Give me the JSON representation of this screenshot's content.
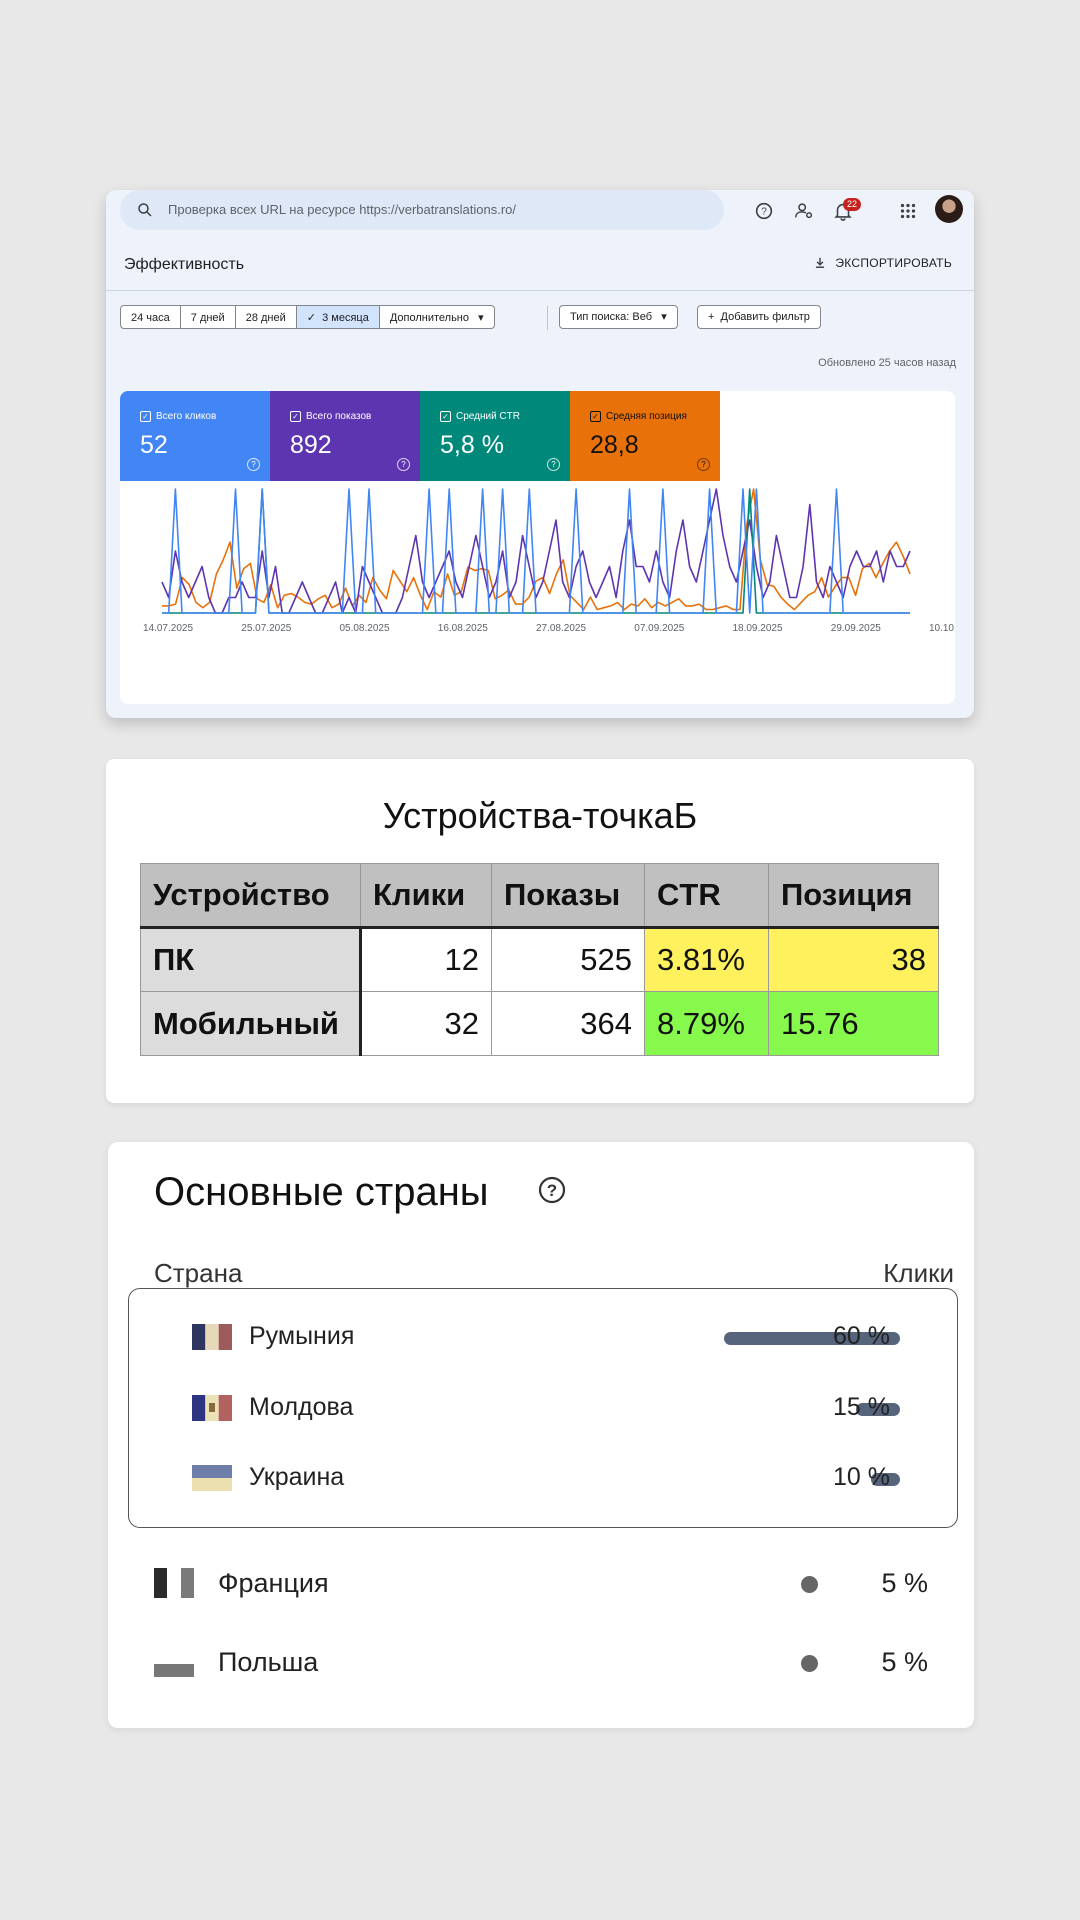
{
  "search_console": {
    "search_placeholder": "Проверка всех URL на ресурсе https://verbatranslations.ro/",
    "notifications_count": "22",
    "page_title": "Эффективность",
    "export_label": "ЭКСПОРТИРОВАТЬ",
    "date_filters": [
      "24 часа",
      "7 дней",
      "28 дней",
      "3 месяца",
      "Дополнительно"
    ],
    "active_date_filter": "3 месяца",
    "search_type_label": "Тип поиска: Веб",
    "add_filter_label": "Добавить фильтр",
    "updated_text": "Обновлено 25 часов назад",
    "metrics": [
      {
        "label": "Всего кликов",
        "value": "52",
        "color": "#4285f4"
      },
      {
        "label": "Всего показов",
        "value": "892",
        "color": "#5e35b1"
      },
      {
        "label": "Средний CTR",
        "value": "5,8 %",
        "color": "#00897b"
      },
      {
        "label": "Средняя позиция",
        "value": "28,8",
        "color": "#e8710a"
      }
    ]
  },
  "chart_data": {
    "type": "line",
    "x_ticks": [
      "14.07.2025",
      "25.07.2025",
      "05.08.2025",
      "16.08.2025",
      "27.08.2025",
      "07.09.2025",
      "18.09.2025",
      "29.09.2025",
      "10.10.2025"
    ],
    "series": [
      {
        "color": "#e8710a",
        "values": [
          4,
          4,
          5,
          20,
          16,
          6,
          3,
          6,
          22,
          30,
          40,
          14,
          25,
          28,
          8,
          6,
          16,
          3,
          10,
          11,
          9,
          6,
          5,
          8,
          10,
          3,
          5,
          14,
          4,
          10,
          6,
          20,
          13,
          8,
          24,
          18,
          12,
          20,
          10,
          2,
          12,
          9,
          22,
          10,
          12,
          26,
          24,
          25,
          24,
          8,
          10,
          13,
          5,
          5,
          9,
          18,
          20,
          11,
          22,
          30,
          10,
          6,
          2,
          9,
          2,
          3,
          4,
          6,
          2,
          5,
          4,
          8,
          3,
          6,
          4,
          6,
          8,
          4,
          4,
          5,
          2,
          2,
          3,
          4,
          2,
          2,
          50,
          70,
          30,
          16,
          15,
          9,
          5,
          2,
          6,
          10,
          12,
          20,
          9,
          15,
          20,
          20,
          10,
          25,
          28,
          20,
          28,
          35,
          40,
          32,
          22
        ]
      },
      {
        "color": "#5e35b1",
        "values": [
          2,
          1,
          4,
          2,
          1,
          2,
          3,
          1,
          0,
          0,
          1,
          1,
          2,
          1,
          1,
          4,
          1,
          3,
          0,
          0,
          1,
          2,
          1,
          0,
          0,
          1,
          2,
          0,
          1,
          0,
          3,
          2,
          1,
          0,
          0,
          0,
          1,
          3,
          5,
          2,
          1,
          2,
          3,
          4,
          2,
          1,
          3,
          5,
          3,
          1,
          2,
          4,
          1,
          2,
          5,
          3,
          1,
          2,
          4,
          6,
          2,
          1,
          3,
          4,
          2,
          1,
          2,
          3,
          1,
          4,
          6,
          3,
          3,
          2,
          4,
          2,
          1,
          4,
          6,
          3,
          2,
          4,
          6,
          8,
          5,
          3,
          2,
          4,
          6,
          3,
          1,
          2,
          5,
          3,
          1,
          1,
          3,
          7,
          2,
          1,
          3,
          2,
          1,
          3,
          4,
          3,
          3,
          4,
          2,
          4,
          3,
          3,
          4
        ]
      },
      {
        "color": "#00897b",
        "values": [
          0,
          0,
          0,
          0,
          0,
          0,
          0,
          0,
          0,
          0,
          0,
          0,
          0,
          0,
          0,
          1,
          0,
          0,
          0,
          0,
          0,
          0,
          0,
          0,
          0,
          0,
          0,
          0,
          0,
          0,
          0,
          0,
          0,
          0,
          0,
          0,
          0,
          0,
          0,
          0,
          0,
          0,
          0,
          0,
          0,
          0,
          0,
          0,
          0,
          0,
          0,
          0,
          0,
          0,
          0,
          0,
          0,
          0,
          0,
          0,
          0,
          0,
          0,
          0,
          0,
          0,
          0,
          0,
          0,
          0,
          0,
          0,
          0,
          0,
          0,
          0,
          0,
          0,
          0,
          0,
          0,
          0,
          0,
          0,
          0,
          0,
          0,
          0,
          1,
          0,
          0,
          0,
          0,
          0,
          0,
          0,
          0,
          0,
          0,
          0,
          0,
          0,
          0,
          0,
          0,
          0,
          0,
          0,
          0,
          0,
          0,
          0,
          0
        ]
      },
      {
        "color": "#4285f4",
        "values": [
          0,
          0,
          1,
          0,
          0,
          0,
          0,
          0,
          0,
          0,
          0,
          1,
          0,
          0,
          0,
          1,
          0,
          0,
          0,
          0,
          0,
          0,
          0,
          0,
          0,
          0,
          0,
          0,
          1,
          0,
          0,
          1,
          0,
          0,
          0,
          0,
          0,
          0,
          0,
          0,
          1,
          0,
          0,
          1,
          0,
          0,
          0,
          0,
          1,
          0,
          0,
          1,
          0,
          0,
          0,
          1,
          0,
          0,
          0,
          0,
          0,
          0,
          1,
          0,
          0,
          0,
          0,
          0,
          0,
          0,
          1,
          0,
          0,
          0,
          0,
          1,
          0,
          0,
          0,
          0,
          0,
          0,
          1,
          0,
          0,
          0,
          0,
          1,
          0,
          1,
          0,
          0,
          0,
          0,
          0,
          0,
          0,
          0,
          0,
          0,
          0,
          1,
          0,
          0,
          0,
          0,
          0,
          0,
          0,
          0,
          0,
          0,
          0
        ]
      }
    ]
  },
  "devices": {
    "title": "Устройства-точкаБ",
    "headers": [
      "Устройство",
      "Клики",
      "Показы",
      "CTR",
      "Позиция"
    ],
    "rows": [
      [
        "ПК",
        "12",
        "525",
        "3.81%",
        "38"
      ],
      [
        "Мобильный",
        "32",
        "364",
        "8.79%",
        "15.76"
      ]
    ]
  },
  "countries": {
    "title": "Основные страны",
    "col_country": "Страна",
    "col_clicks": "Клики",
    "items": [
      {
        "name": "Румыния",
        "pct": "60 %",
        "share": 60
      },
      {
        "name": "Молдова",
        "pct": "15 %",
        "share": 15
      },
      {
        "name": "Украина",
        "pct": "10 %",
        "share": 10
      },
      {
        "name": "Франция",
        "pct": "5 %",
        "share": 5
      },
      {
        "name": "Польша",
        "pct": "5 %",
        "share": 5
      }
    ]
  }
}
